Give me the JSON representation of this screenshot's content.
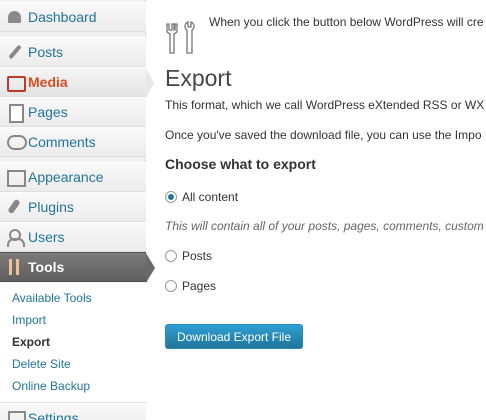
{
  "sidebar": {
    "items": [
      {
        "label": "Dashboard",
        "icon": "dashboard-icon"
      },
      {
        "label": "Posts",
        "icon": "posts-icon"
      },
      {
        "label": "Media",
        "icon": "media-icon"
      },
      {
        "label": "Pages",
        "icon": "pages-icon"
      },
      {
        "label": "Comments",
        "icon": "comments-icon"
      },
      {
        "label": "Appearance",
        "icon": "appearance-icon"
      },
      {
        "label": "Plugins",
        "icon": "plugins-icon"
      },
      {
        "label": "Users",
        "icon": "users-icon"
      },
      {
        "label": "Tools",
        "icon": "tools-icon"
      },
      {
        "label": "Settings",
        "icon": "settings-icon"
      }
    ],
    "submenu": [
      {
        "label": "Available Tools"
      },
      {
        "label": "Import"
      },
      {
        "label": "Export"
      },
      {
        "label": "Delete Site"
      },
      {
        "label": "Online Backup"
      }
    ]
  },
  "main": {
    "intro": "When you click the button below WordPress will cre",
    "title": "Export",
    "para1": "This format, which we call WordPress eXtended RSS or WX",
    "para2": "Once you've saved the download file, you can use the Impo",
    "choose_heading": "Choose what to export",
    "options": [
      {
        "label": "All content",
        "checked": true
      },
      {
        "label": "Posts",
        "checked": false
      },
      {
        "label": "Pages",
        "checked": false
      }
    ],
    "description": "This will contain all of your posts, pages, comments, custom",
    "download_button": "Download Export File"
  },
  "colors": {
    "accent": "#21759b",
    "media": "#d54e21",
    "tools_bg": "#6a6a6a"
  }
}
